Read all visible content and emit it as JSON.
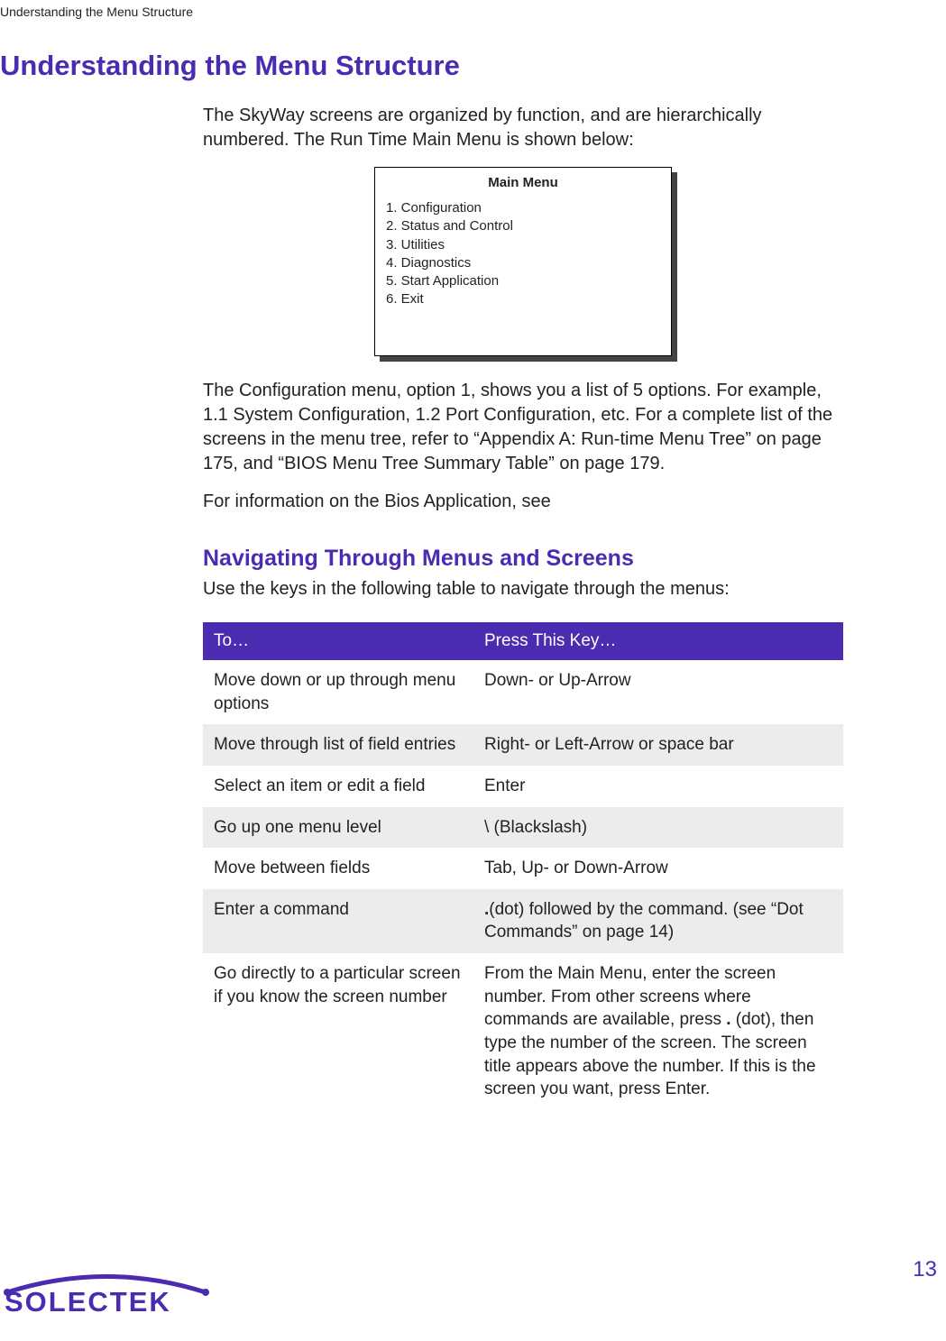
{
  "header": "Understanding the Menu Structure",
  "h1": "Understanding the Menu Structure",
  "intro": "The SkyWay screens are organized by function, and are hierarchically numbered. The Run Time Main Menu is shown below:",
  "main_menu": {
    "title": "Main Menu",
    "items": [
      "1.  Configuration",
      "2.  Status and Control",
      "3.  Utilities",
      "4.  Diagnostics",
      "5.  Start Application",
      "6.  Exit"
    ]
  },
  "para2": "The Configuration menu, option 1, shows you a list of 5 options. For example, 1.1 System Configuration, 1.2 Port Configuration, etc. For a complete list of the screens in the menu tree, refer to “Appendix A: Run-time Menu Tree” on page 175, and “BIOS Menu Tree Summary Table” on page 179.",
  "para3": "For information on the Bios Application, see",
  "h2": "Navigating Through Menus and Screens",
  "para4": "Use the keys in the following table to navigate through the menus:",
  "table": {
    "head": {
      "col1": "To…",
      "col2": "Press This Key…"
    },
    "rows": [
      {
        "to": "Move down or up through menu options",
        "key": "Down- or Up-Arrow"
      },
      {
        "to": "Move through list of field entries",
        "key": "Right- or Left-Arrow or space bar"
      },
      {
        "to": "Select an item or edit a field",
        "key": "Enter"
      },
      {
        "to": "Go up one menu level",
        "key": "\\ (Blackslash)"
      },
      {
        "to": "Move between fields",
        "key": "Tab, Up- or Down-Arrow"
      },
      {
        "to": "Enter a command",
        "key_prefix": ".",
        "key": "(dot) followed by the command. (see “Dot Commands” on page 14)"
      },
      {
        "to": "Go directly to a particular screen if you know the screen number",
        "key_pre": "From the Main Menu, enter the screen number. From other screens where commands are available, press ",
        "key_dot": ".",
        "key_post": " (dot), then type the number of the screen. The screen title appears above the number. If this is the screen you want, press Enter."
      }
    ]
  },
  "page_number": "13",
  "logo_text": "SOLECTEK"
}
